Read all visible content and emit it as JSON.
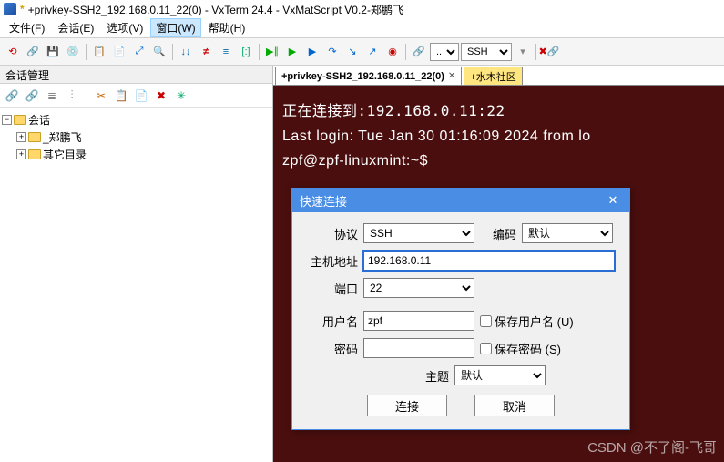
{
  "title": {
    "star": "*",
    "text": "+privkey-SSH2_192.168.0.11_22(0) - VxTerm 24.4 - VxMatScript V0.2-郑鹏飞"
  },
  "menu": {
    "file": "文件(F)",
    "session": "会话(E)",
    "options": "选项(V)",
    "window": "窗口(W)",
    "help": "帮助(H)"
  },
  "toolbar": {
    "combo1": "...",
    "combo2": "SSH"
  },
  "sidebar": {
    "title": "会话管理",
    "root": "会话",
    "nodes": [
      "_郑鹏飞",
      "其它目录"
    ]
  },
  "tabs": {
    "main": "+privkey-SSH2_192.168.0.11_22(0)",
    "community": "+水木社区"
  },
  "terminal": {
    "line1a": "正在连接到",
    "line1b": ":192.168.0.11:22",
    "line2": "Last login: Tue Jan 30 01:16:09 2024 from lo",
    "prompt": "zpf@zpf-linuxmint:~$"
  },
  "dialog": {
    "title": "快速连接",
    "labels": {
      "protocol": "协议",
      "encoding": "编码",
      "host": "主机地址",
      "port": "端口",
      "user": "用户名",
      "pass": "密码",
      "theme": "主题"
    },
    "values": {
      "protocol": "SSH",
      "encoding": "默认",
      "host": "192.168.0.11",
      "port": "22",
      "user": "zpf",
      "theme": "默认"
    },
    "check": {
      "saveuser": "保存用户名 (U)",
      "savepass": "保存密码 (S)"
    },
    "buttons": {
      "connect": "连接",
      "cancel": "取消"
    }
  },
  "watermark": "CSDN @不了阁-飞哥"
}
